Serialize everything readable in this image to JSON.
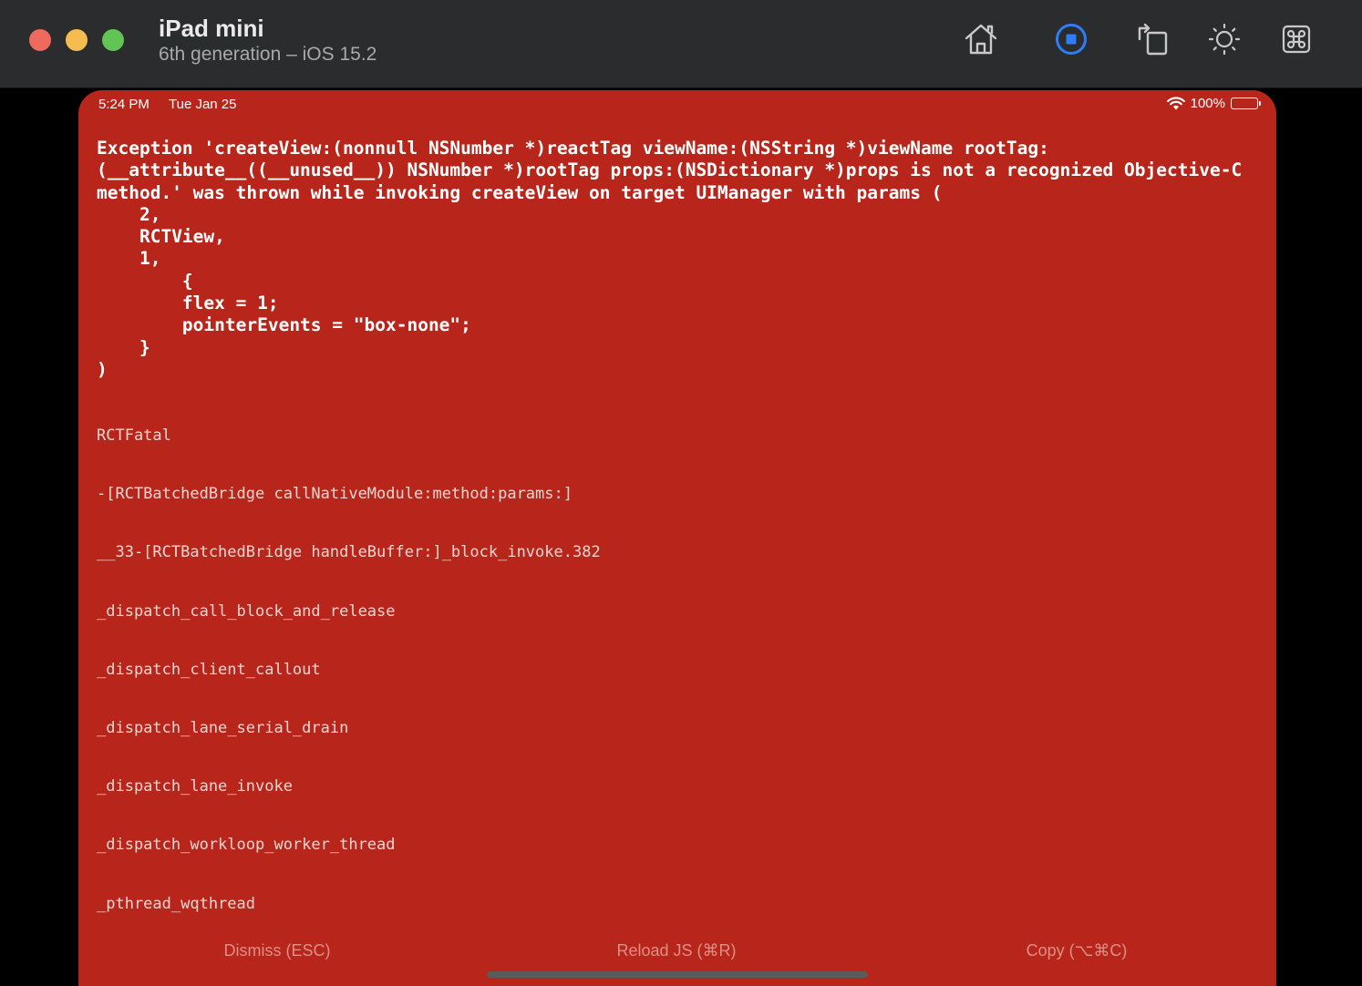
{
  "window": {
    "title": "iPad mini",
    "subtitle": "6th generation – iOS 15.2",
    "toolbar": [
      {
        "name": "home-icon"
      },
      {
        "name": "stop-icon"
      },
      {
        "name": "rotate-icon"
      },
      {
        "name": "appearance-icon"
      },
      {
        "name": "command-icon"
      }
    ]
  },
  "status_bar": {
    "time": "5:24 PM",
    "date": "Tue Jan 25",
    "battery": "100%"
  },
  "error": {
    "message": "Exception 'createView:(nonnull NSNumber *)reactTag viewName:(NSString *)viewName rootTag:(__attribute__((__unused__)) NSNumber *)rootTag props:(NSDictionary *)props is not a recognized Objective-C method.' was thrown while invoking createView on target UIManager with params (\n    2,\n    RCTView,\n    1,\n        {\n        flex = 1;\n        pointerEvents = \"box-none\";\n    }\n)"
  },
  "stack_trace": [
    "RCTFatal",
    "-[RCTBatchedBridge callNativeModule:method:params:]",
    "__33-[RCTBatchedBridge handleBuffer:]_block_invoke.382",
    "_dispatch_call_block_and_release",
    "_dispatch_client_callout",
    "_dispatch_lane_serial_drain",
    "_dispatch_lane_invoke",
    "_dispatch_workloop_worker_thread",
    "_pthread_wqthread"
  ],
  "actions": {
    "dismiss": "Dismiss (ESC)",
    "reload": "Reload JS (⌘R)",
    "copy": "Copy (⌥⌘C)"
  },
  "colors": {
    "redbox_bg": "#b8261b",
    "titlebar_bg": "#2b2c2e",
    "stop_accent": "#2f7df6"
  }
}
